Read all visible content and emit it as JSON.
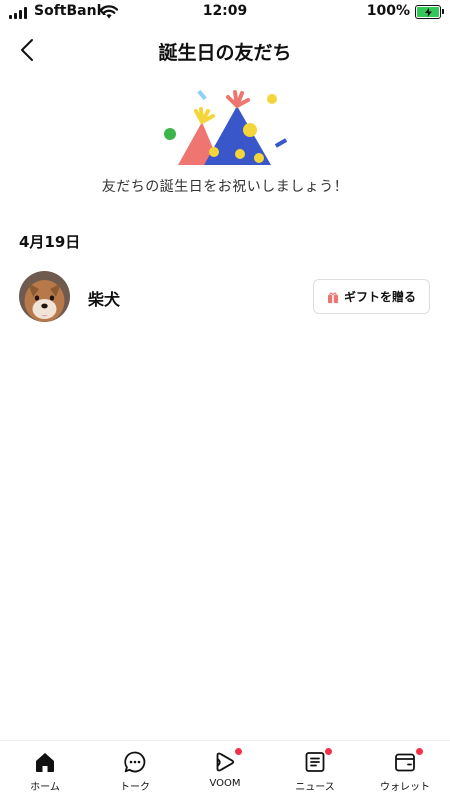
{
  "status_bar": {
    "carrier": "SoftBank",
    "time": "12:09",
    "battery_percent": "100%"
  },
  "header": {
    "title": "誕生日の友だち"
  },
  "illustration": {
    "name": "party-hats",
    "greeting": "友だちの誕生日をお祝いしましょう！"
  },
  "section": {
    "date": "4月19日",
    "friends": [
      {
        "name": "柴犬",
        "gift_button_label": "ギフトを贈る"
      }
    ]
  },
  "tabs": [
    {
      "label": "ホーム",
      "icon": "home-icon",
      "badge": false
    },
    {
      "label": "トーク",
      "icon": "chat-icon",
      "badge": false
    },
    {
      "label": "VOOM",
      "icon": "voom-icon",
      "badge": true
    },
    {
      "label": "ニュース",
      "icon": "news-icon",
      "badge": true
    },
    {
      "label": "ウォレット",
      "icon": "wallet-icon",
      "badge": true
    }
  ],
  "colors": {
    "badge": "#f2324a",
    "hat_pink": "#ef7670",
    "hat_blue": "#3a57c9",
    "confetti_yellow": "#f5d63a",
    "confetti_green": "#3cb54a",
    "battery_fill": "#34c759"
  }
}
